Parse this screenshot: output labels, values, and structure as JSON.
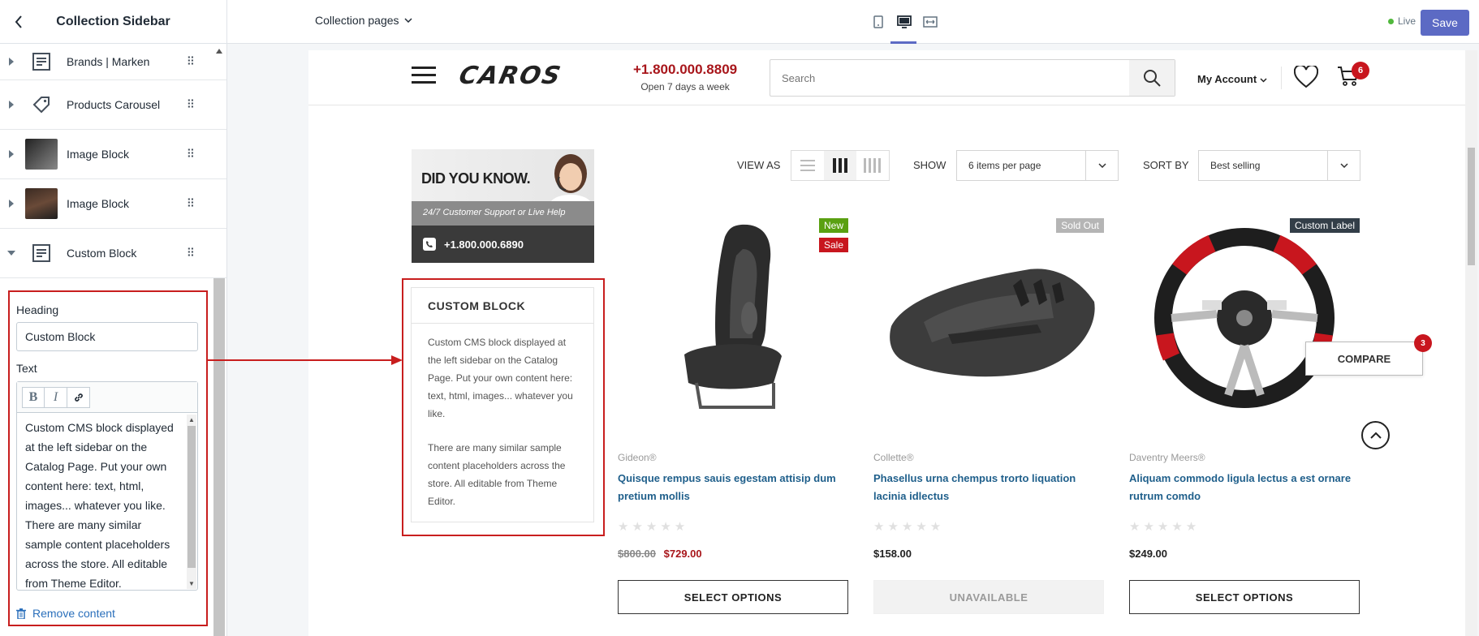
{
  "sidebar": {
    "title": "Collection Sidebar",
    "items": [
      {
        "label": "Brands | Marken",
        "icon": "text-block-icon"
      },
      {
        "label": "Products Carousel",
        "icon": "tag-icon"
      },
      {
        "label": "Image Block",
        "icon": "image-thumbnail"
      },
      {
        "label": "Image Block",
        "icon": "image-thumbnail"
      },
      {
        "label": "Custom Block",
        "icon": "text-block-icon",
        "expanded": true
      }
    ],
    "panel": {
      "heading_label": "Heading",
      "heading_value": "Custom Block",
      "text_label": "Text",
      "toolbar": {
        "bold": "B",
        "italic": "I"
      },
      "text_value": "Custom CMS block displayed at the left sidebar on the Catalog Page. Put your own content here: text, html, images... whatever you like. There are many similar sample content placeholders across the store. All editable from Theme Editor.",
      "remove_label": "Remove content"
    }
  },
  "topbar": {
    "page_select": "Collection pages",
    "live_label": "Live",
    "save_label": "Save",
    "colors": {
      "accent": "#5c6ac4",
      "live": "#50b83c"
    }
  },
  "store": {
    "logo": "CAROS",
    "phone": "+1.800.000.8809",
    "phone_sub": "Open 7 days a week",
    "search_placeholder": "Search",
    "account": "My Account",
    "cart_count": "6",
    "promo": {
      "title": "DID YOU KNOW.",
      "subtitle": "24/7 Customer Support or Live Help",
      "phone": "+1.800.000.6890"
    },
    "custom_block": {
      "heading": "CUSTOM BLOCK",
      "para1": "Custom CMS block displayed at the left sidebar on the Catalog Page. Put your own content here: text, html, images... whatever you like.",
      "para2": "There are many similar sample content placeholders across the store. All editable from Theme Editor."
    },
    "toolbar": {
      "view_as": "VIEW AS",
      "show": "SHOW",
      "show_value": "6 items per page",
      "sort_by": "SORT BY",
      "sort_value": "Best selling"
    },
    "products": [
      {
        "brand": "Gideon®",
        "title": "Quisque rempus sauis egestam attisip dum pretium mollis",
        "old_price": "$800.00",
        "price": "$729.00",
        "button": "SELECT OPTIONS",
        "badges": [
          "New",
          "Sale"
        ]
      },
      {
        "brand": "Collette®",
        "title": "Phasellus urna chempus trorto liquation lacinia idlectus",
        "price": "$158.00",
        "button": "UNAVAILABLE",
        "badges": [
          "Sold Out"
        ]
      },
      {
        "brand": "Daventry Meers®",
        "title": "Aliquam commodo ligula lectus a est ornare rutrum comdo",
        "price": "$249.00",
        "button": "SELECT OPTIONS",
        "badges": [
          "Custom Label"
        ]
      }
    ],
    "compare_label": "COMPARE",
    "compare_count": "3",
    "colors": {
      "price_red": "#a8161b",
      "title_blue": "#1f5f8b",
      "badge_new": "#5aa011",
      "badge_sale": "#c8161e",
      "badge_soldout": "#b5b5b5",
      "badge_custom": "#333e48",
      "highlight": "#c81e1e"
    }
  }
}
